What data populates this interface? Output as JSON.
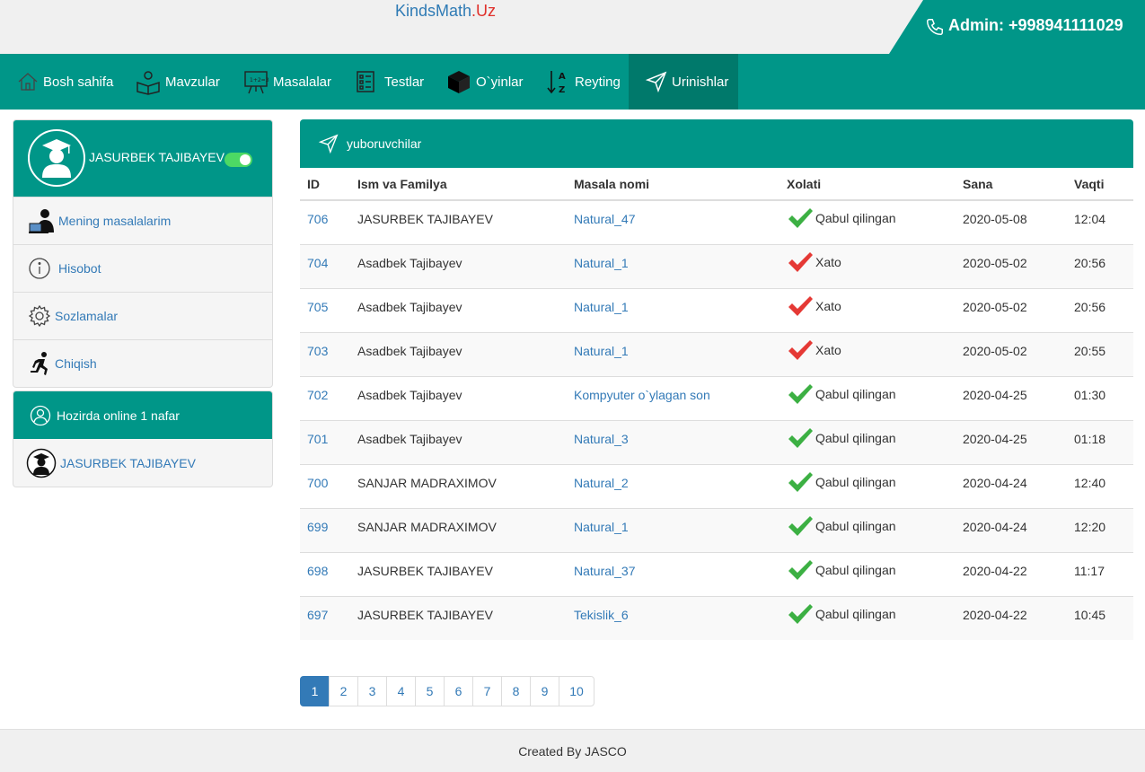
{
  "header": {
    "logo_part1": "KindsMath",
    "logo_part2": ".Uz",
    "admin_label": "Admin: +998941111029"
  },
  "nav": {
    "items": [
      {
        "label": "Bosh sahifa",
        "icon": "home-icon"
      },
      {
        "label": "Mavzular",
        "icon": "reader-icon"
      },
      {
        "label": "Masalalar",
        "icon": "board-icon"
      },
      {
        "label": "Testlar",
        "icon": "checklist-icon"
      },
      {
        "label": "O`yinlar",
        "icon": "cube-icon"
      },
      {
        "label": "Reyting",
        "icon": "sort-az-icon"
      },
      {
        "label": "Urinishlar",
        "icon": "send-icon",
        "active": true
      }
    ]
  },
  "sidebar": {
    "user_name": "JASURBEK TAJIBAYEV",
    "items": [
      {
        "label": "Mening masalalarim",
        "icon": "user-desk-icon"
      },
      {
        "label": "Hisobot",
        "icon": "info-icon"
      },
      {
        "label": "Sozlamalar",
        "icon": "gear-icon"
      },
      {
        "label": "Chiqish",
        "icon": "running-icon"
      }
    ],
    "online_title": "Hozirda online 1 nafar",
    "online_users": [
      "JASURBEK TAJIBAYEV"
    ]
  },
  "panel": {
    "title": "yuboruvchilar",
    "columns": [
      "ID",
      "Ism va Familya",
      "Masala nomi",
      "Xolati",
      "Sana",
      "Vaqti"
    ],
    "rows": [
      {
        "id": "706",
        "name": "JASURBEK TAJIBAYEV",
        "problem": "Natural_47",
        "status": "Qabul qilingan",
        "ok": true,
        "date": "2020-05-08",
        "time": "12:04"
      },
      {
        "id": "704",
        "name": "Asadbek Tajibayev",
        "problem": "Natural_1",
        "status": "Xato",
        "ok": false,
        "date": "2020-05-02",
        "time": "20:56"
      },
      {
        "id": "705",
        "name": "Asadbek Tajibayev",
        "problem": "Natural_1",
        "status": "Xato",
        "ok": false,
        "date": "2020-05-02",
        "time": "20:56"
      },
      {
        "id": "703",
        "name": "Asadbek Tajibayev",
        "problem": "Natural_1",
        "status": "Xato",
        "ok": false,
        "date": "2020-05-02",
        "time": "20:55"
      },
      {
        "id": "702",
        "name": "Asadbek Tajibayev",
        "problem": "Kompyuter o`ylagan son",
        "status": "Qabul qilingan",
        "ok": true,
        "date": "2020-04-25",
        "time": "01:30"
      },
      {
        "id": "701",
        "name": "Asadbek Tajibayev",
        "problem": "Natural_3",
        "status": "Qabul qilingan",
        "ok": true,
        "date": "2020-04-25",
        "time": "01:18"
      },
      {
        "id": "700",
        "name": "SANJAR MADRAXIMOV",
        "problem": "Natural_2",
        "status": "Qabul qilingan",
        "ok": true,
        "date": "2020-04-24",
        "time": "12:40"
      },
      {
        "id": "699",
        "name": "SANJAR MADRAXIMOV",
        "problem": "Natural_1",
        "status": "Qabul qilingan",
        "ok": true,
        "date": "2020-04-24",
        "time": "12:20"
      },
      {
        "id": "698",
        "name": "JASURBEK TAJIBAYEV",
        "problem": "Natural_37",
        "status": "Qabul qilingan",
        "ok": true,
        "date": "2020-04-22",
        "time": "11:17"
      },
      {
        "id": "697",
        "name": "JASURBEK TAJIBAYEV",
        "problem": "Tekislik_6",
        "status": "Qabul qilingan",
        "ok": true,
        "date": "2020-04-22",
        "time": "10:45"
      }
    ]
  },
  "pagination": {
    "pages": [
      "1",
      "2",
      "3",
      "4",
      "5",
      "6",
      "7",
      "8",
      "9",
      "10"
    ],
    "active": "1"
  },
  "footer": {
    "text": "Created By JASCO"
  },
  "colors": {
    "primary": "#009688",
    "primary_dark": "#00796b",
    "link": "#337ab7",
    "ok": "#3cb043",
    "error": "#e53935"
  }
}
